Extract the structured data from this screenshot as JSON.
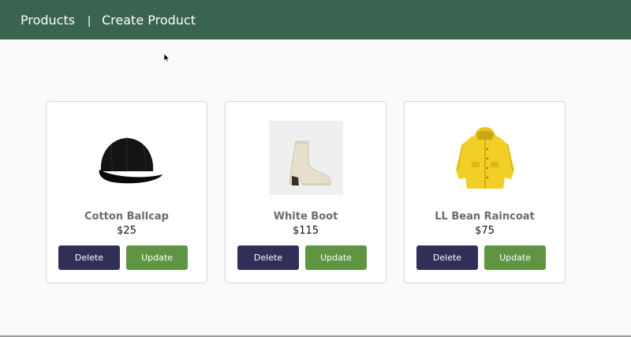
{
  "navbar": {
    "products_label": "Products",
    "separator": "|",
    "create_label": "Create Product",
    "bg_color": "#3a6350"
  },
  "products": [
    {
      "title": "Cotton Ballcap",
      "price": "$25",
      "delete_label": "Delete",
      "update_label": "Update",
      "image": "black-cap-icon"
    },
    {
      "title": "White Boot",
      "price": "$115",
      "delete_label": "Delete",
      "update_label": "Update",
      "image": "white-boot-icon"
    },
    {
      "title": "LL Bean Raincoat",
      "price": "$75",
      "delete_label": "Delete",
      "update_label": "Update",
      "image": "yellow-raincoat-icon"
    }
  ],
  "colors": {
    "delete_button": "#2f2f57",
    "update_button": "#5f9442"
  }
}
